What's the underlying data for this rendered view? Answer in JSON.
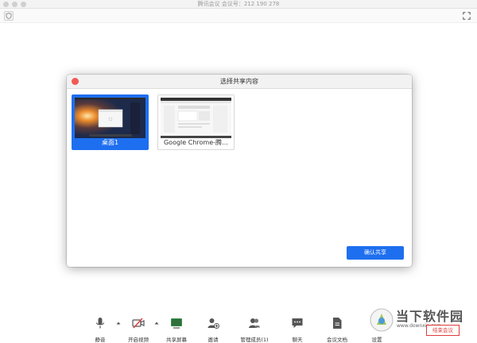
{
  "window": {
    "title": "腾讯会议 会议号：212 190 278"
  },
  "dialog": {
    "title": "选择共享内容",
    "cards": [
      {
        "label": "桌面1",
        "selected": true
      },
      {
        "label": "Google Chrome-腾…",
        "selected": false
      }
    ],
    "confirm_label": "确认共享"
  },
  "toolbar": {
    "items": [
      {
        "label": "静音",
        "icon": "microphone-icon"
      },
      {
        "label": "开启视频",
        "icon": "video-off-icon"
      },
      {
        "label": "共享屏幕",
        "icon": "share-screen-icon"
      },
      {
        "label": "邀请",
        "icon": "invite-user-icon"
      },
      {
        "label": "管理成员(1)",
        "icon": "members-icon"
      },
      {
        "label": "聊天",
        "icon": "chat-icon"
      },
      {
        "label": "会议文档",
        "icon": "document-icon"
      },
      {
        "label": "设置",
        "icon": "settings-icon"
      }
    ],
    "end_label": "结束会议"
  },
  "watermark": {
    "brand": "当下软件园",
    "url": "www.downxia.com"
  },
  "colors": {
    "accent": "#1e6ff0",
    "close_dot": "#f25b55",
    "end_red": "#e03a3a"
  }
}
